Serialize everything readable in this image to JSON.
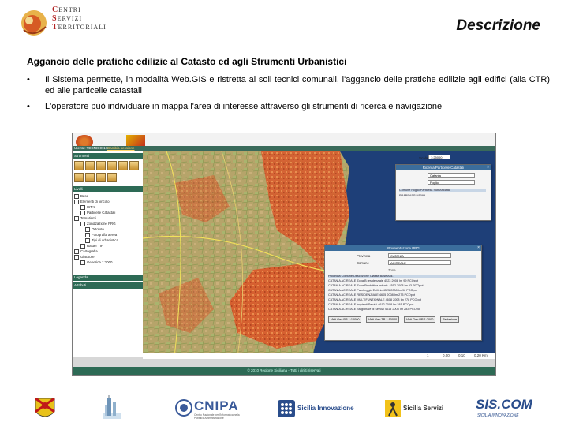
{
  "header": {
    "logo_lines": [
      [
        "C",
        "ENTRI"
      ],
      [
        "S",
        "ERVIZI"
      ],
      [
        "T",
        "ERRITORIALI"
      ]
    ],
    "title": "Descrizione"
  },
  "content": {
    "subtitle": "Aggancio delle pratiche edilizie al Catasto ed agli Strumenti Urbanistici",
    "bullets": [
      "Il Sistema permette, in modalità Web.GIS e ristretta ai soli tecnici comunali, l'aggancio delle pratiche edilizie agli edifici (alla CTR) ed alle particelle catastali",
      "L'operatore può individuare in mappa l'area di interesse  attraverso gli strumenti di ricerca e navigazione"
    ],
    "bullet_symbol": "•"
  },
  "screenshot": {
    "nav_user": "Utente: TECNICO 1S",
    "nav_link": "Cambia sessione",
    "panel_tools": "Strumenti",
    "panel_layers": "Livelli",
    "panel_legend": "Legenda",
    "panel_attributes": "Attributi",
    "layers": [
      "Base",
      "Elementi di vincolo",
      "ISTAt",
      "Particelle Catastali",
      "Tematismi",
      "Zonizzazione PRG",
      "Ortofoto",
      "Fotografia aerea",
      "Tipi di urbanistica",
      "Raster TIF",
      "Cartografia",
      "Giacitore",
      "Generica 1:2000"
    ],
    "scale_label": "Scala",
    "scale_value": "1:25000",
    "catasto_panel": {
      "title": "Ricerca Particelle Catastali",
      "field1": "Catania",
      "field2": "Foglio",
      "columns": "Comune  Foglio Particella Sub Affidata",
      "rows": [
        "PRABBASSI  45099  ---  --"
      ]
    },
    "prg_panel": {
      "title": "Strumentazione PRG",
      "label_provincia": "Provincia",
      "label_comune": "Comune",
      "label_zona": "Zona",
      "provincia": "CATANIA",
      "comune": "ACIREALE",
      "columns": "Provincia  Comune  Descrizione   Classe   Base Ass.",
      "rows": [
        "CATANIA  ACIREALE   Zona B residenziale   4523 2008 Im 99 PCOpot",
        "CATANIA  ACIREALE   Zona Produttiva industr.   4512 2008 Im 93 PCOpot",
        "CATANIA  ACIREALE   Parcheggio Edilizio   4525 2008 Im 96 PCOpot",
        "CATANIA  ACIREALE   RESIDENZIALE    4605 2008 Im 273 PCOpot",
        "CATANIA  ACIREALE   MULTIFUNZIONALE   4608 2008 Im 278 PCOpot",
        "CATANIA  ACIREALE   Impianti Servizi   4612 2008 Im 281 PCOpot",
        "CATANIA  ACIREALE   Stagionale di Servizi   4615 2008 Im 283 PCOpot"
      ],
      "buttons": [
        "Visti Geo PR 1:10000",
        "Visti Geo TR 1:10000",
        "Visti Geo PR 1:2000",
        "Redazione"
      ]
    },
    "footer": "© 2010 Regione Siciliana - Tutti i diritti riservati",
    "scale_ticks": [
      "1",
      "0,00",
      "0,10",
      "0,20 Km"
    ]
  },
  "footer_logos": {
    "cnipa_main": "CNIPA",
    "cnipa_sub": "Centro Nazionale per l'Informatica nella Pubblica Amministrazione",
    "sicilia_innovazione": "Sicilia Innovazione",
    "sicilia_servizi": "Sicilia Servizi",
    "siscom": "SIS.COM",
    "siscom_sub": "SICILIA INNOVAZIONE"
  },
  "colors": {
    "accent_green": "#2d6a55",
    "accent_blue": "#3b6d9c",
    "map_sea": "#1e3f78",
    "map_urban": "#d9582a",
    "map_land": "#b8a36a"
  }
}
